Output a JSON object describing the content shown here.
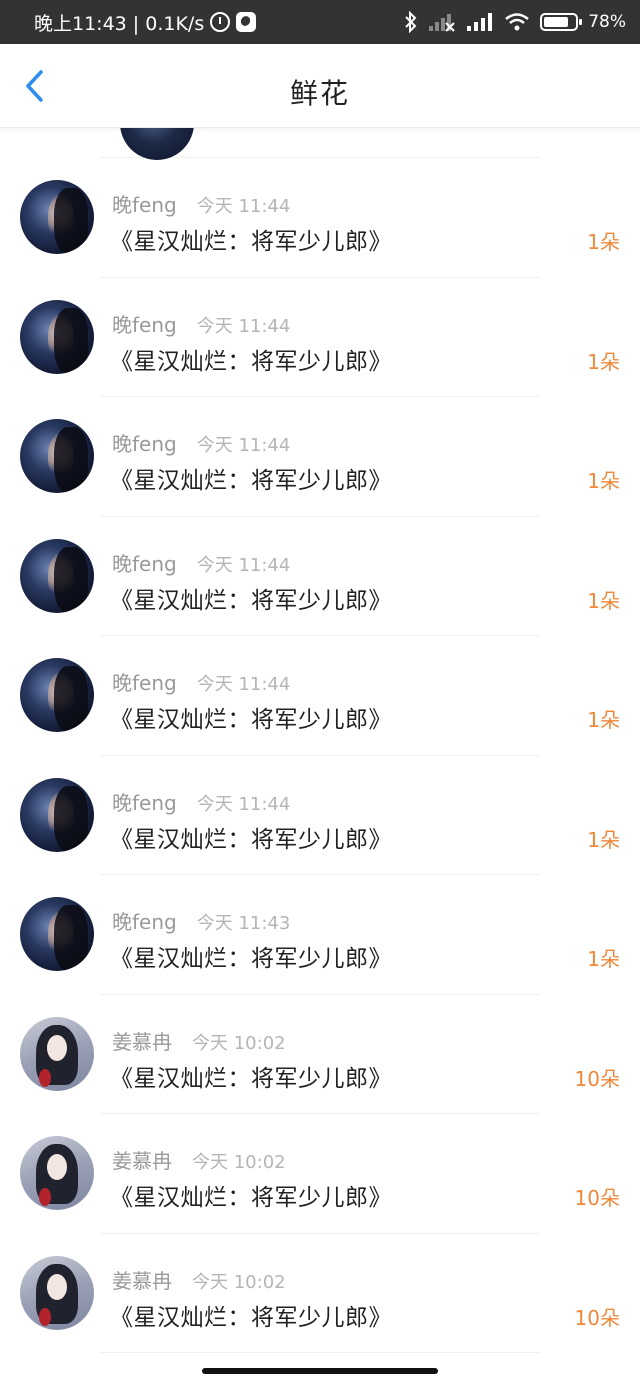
{
  "status_bar": {
    "time_speed": "晚上11:43 | 0.1K/s",
    "battery": "78%",
    "battery_level": 0.78,
    "icons": [
      "alarm-icon",
      "app-icon",
      "bluetooth-icon",
      "signal-off-icon",
      "signal-icon",
      "wifi-icon",
      "battery-icon"
    ]
  },
  "header": {
    "title": "鲜花",
    "back_icon": "chevron-left-icon",
    "accent_color": "#2f8cf0"
  },
  "list": {
    "rows": [
      {
        "user": "晚feng",
        "time": "今天 11:44",
        "book": "《星汉灿烂：将军少儿郎》",
        "count": "1朵",
        "avatar": "dark"
      },
      {
        "user": "晚feng",
        "time": "今天 11:44",
        "book": "《星汉灿烂：将军少儿郎》",
        "count": "1朵",
        "avatar": "dark"
      },
      {
        "user": "晚feng",
        "time": "今天 11:44",
        "book": "《星汉灿烂：将军少儿郎》",
        "count": "1朵",
        "avatar": "dark"
      },
      {
        "user": "晚feng",
        "time": "今天 11:44",
        "book": "《星汉灿烂：将军少儿郎》",
        "count": "1朵",
        "avatar": "dark"
      },
      {
        "user": "晚feng",
        "time": "今天 11:44",
        "book": "《星汉灿烂：将军少儿郎》",
        "count": "1朵",
        "avatar": "dark"
      },
      {
        "user": "晚feng",
        "time": "今天 11:44",
        "book": "《星汉灿烂：将军少儿郎》",
        "count": "1朵",
        "avatar": "dark"
      },
      {
        "user": "晚feng",
        "time": "今天 11:43",
        "book": "《星汉灿烂：将军少儿郎》",
        "count": "1朵",
        "avatar": "dark"
      },
      {
        "user": "姜慕冉",
        "time": "今天 10:02",
        "book": "《星汉灿烂：将军少儿郎》",
        "count": "10朵",
        "avatar": "light"
      },
      {
        "user": "姜慕冉",
        "time": "今天 10:02",
        "book": "《星汉灿烂：将军少儿郎》",
        "count": "10朵",
        "avatar": "light"
      },
      {
        "user": "姜慕冉",
        "time": "今天 10:02",
        "book": "《星汉灿烂：将军少儿郎》",
        "count": "10朵",
        "avatar": "light"
      }
    ],
    "count_color": "#f0883a"
  }
}
